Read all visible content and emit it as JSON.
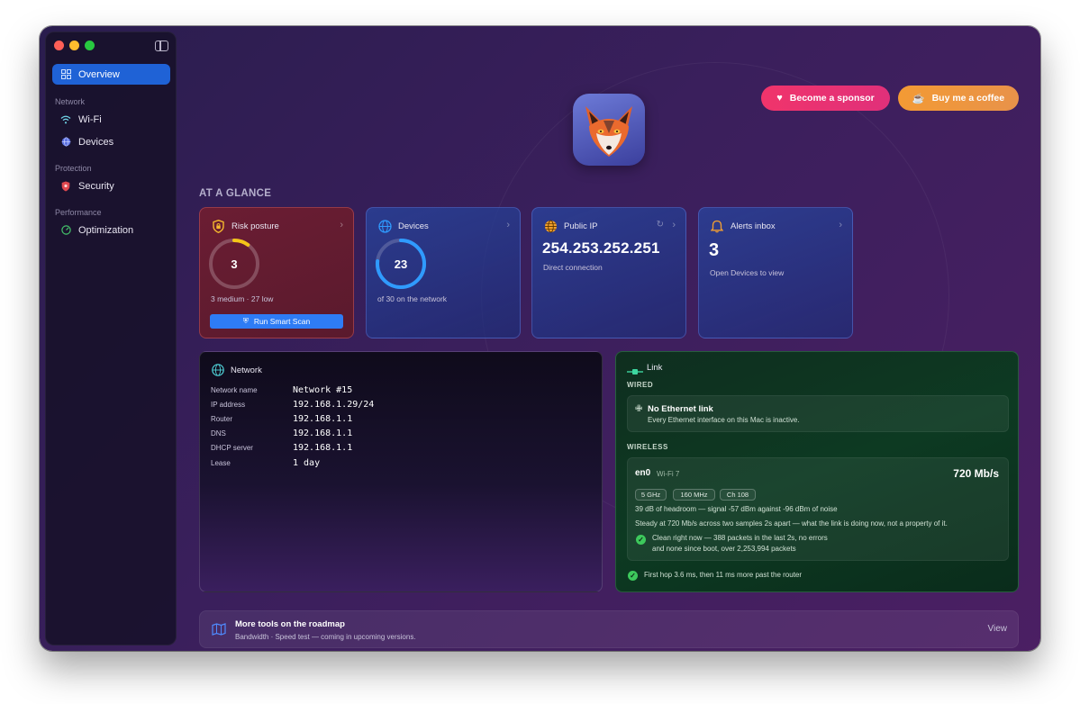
{
  "sidebar": {
    "overview": "Overview",
    "network_section": "Network",
    "wifi": "Wi-Fi",
    "devices": "Devices",
    "protection_section": "Protection",
    "security": "Security",
    "performance_section": "Performance",
    "optimization": "Optimization"
  },
  "header": {
    "sponsor_label": "Become a sponsor",
    "coffee_label": "Buy me a coffee"
  },
  "glance": {
    "title": "AT A GLANCE",
    "risk": {
      "title": "Risk posture",
      "value": "3",
      "subtitle": "3 medium · 27 low",
      "scan_label": "Run Smart Scan",
      "fraction": 0.1
    },
    "devices": {
      "title": "Devices",
      "value": "23",
      "subtitle": "of 30 on the network",
      "fraction": 0.767
    },
    "public_ip": {
      "title": "Public IP",
      "value": "254.253.252.251",
      "subtitle": "Direct connection"
    },
    "alerts": {
      "title": "Alerts inbox",
      "value": "3",
      "subtitle": "Open Devices to view"
    }
  },
  "network": {
    "title": "Network",
    "rows": [
      {
        "key": "Network name",
        "value": "Network #15"
      },
      {
        "key": "IP address",
        "value": "192.168.1.29/24"
      },
      {
        "key": "Router",
        "value": "192.168.1.1"
      },
      {
        "key": "DNS",
        "value": "192.168.1.1"
      },
      {
        "key": "DHCP server",
        "value": "192.168.1.1"
      },
      {
        "key": "Lease",
        "value": "1 day"
      }
    ]
  },
  "link": {
    "title": "Link",
    "wired_label": "WIRED",
    "wired_title": "No Ethernet link",
    "wired_sub": "Every Ethernet interface on this Mac is inactive.",
    "wireless_label": "WIRELESS",
    "iface": "en0",
    "iface_type": "Wi-Fi 7",
    "speed": "720 Mb/s",
    "chips": [
      "5 GHz",
      "160 MHz",
      "Ch 108"
    ],
    "signal_text": "39 dB of headroom — signal -57 dBm against -96 dBm of noise",
    "steady_text": "Steady at 720 Mb/s across two samples 2s apart — what the link is doing now, not a property of it.",
    "clean_line1": "Clean right now — 388 packets in the last 2s, no errors",
    "clean_line2": "and none since boot, over 2,253,994 packets",
    "hop_text": "First hop 3.6 ms, then 11 ms more past the router"
  },
  "roadmap": {
    "title": "More tools on the roadmap",
    "subtitle": "Bandwidth · Speed test — coming in upcoming versions.",
    "view_label": "View"
  },
  "colors": {
    "accent": "#1f62d6",
    "risk_ring": "#f5c518",
    "devices_ring": "#2f9bff",
    "ok_green": "#3dc95c"
  }
}
